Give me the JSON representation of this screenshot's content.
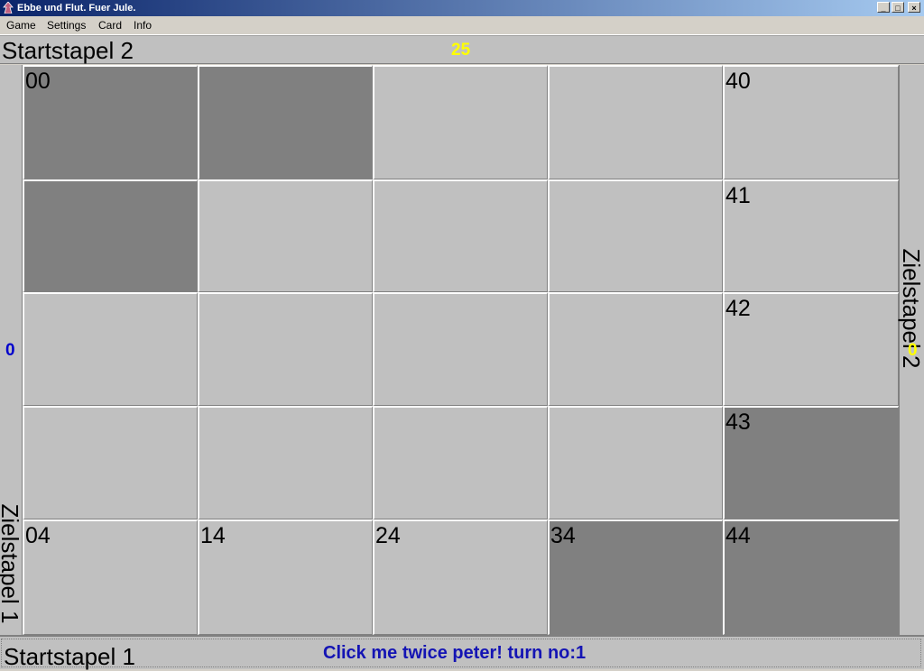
{
  "window": {
    "title": "Ebbe und Flut. Fuer Jule.",
    "buttons": [
      "_",
      "□",
      "×"
    ]
  },
  "menu": [
    "Game",
    "Settings",
    "Card",
    "Info"
  ],
  "top": {
    "label": "Startstapel 2",
    "count": "25"
  },
  "left": {
    "label": "Zielstapel 1",
    "count": "0"
  },
  "right": {
    "label": "Zielstapel 2",
    "count": "0"
  },
  "bottom": {
    "label": "Startstapel 1",
    "status": "Click me twice peter! turn no:1"
  },
  "colors": {
    "light_cell": "#c0c0c0",
    "dark_cell": "#808080",
    "yellow_count": "#ffff00",
    "blue_count": "#0000cc",
    "status": "#1414b4"
  },
  "board": {
    "rows": [
      [
        {
          "label": "00",
          "dark": true
        },
        {
          "label": "",
          "dark": true
        },
        {
          "label": "",
          "dark": false
        },
        {
          "label": "",
          "dark": false
        },
        {
          "label": "40",
          "dark": false
        }
      ],
      [
        {
          "label": "",
          "dark": true
        },
        {
          "label": "",
          "dark": false
        },
        {
          "label": "",
          "dark": false
        },
        {
          "label": "",
          "dark": false
        },
        {
          "label": "41",
          "dark": false
        }
      ],
      [
        {
          "label": "",
          "dark": false
        },
        {
          "label": "",
          "dark": false
        },
        {
          "label": "",
          "dark": false
        },
        {
          "label": "",
          "dark": false
        },
        {
          "label": "42",
          "dark": false
        }
      ],
      [
        {
          "label": "",
          "dark": false
        },
        {
          "label": "",
          "dark": false
        },
        {
          "label": "",
          "dark": false
        },
        {
          "label": "",
          "dark": false
        },
        {
          "label": "43",
          "dark": true
        }
      ],
      [
        {
          "label": "04",
          "dark": false
        },
        {
          "label": "14",
          "dark": false
        },
        {
          "label": "24",
          "dark": false
        },
        {
          "label": "34",
          "dark": true
        },
        {
          "label": "44",
          "dark": true
        }
      ]
    ]
  }
}
